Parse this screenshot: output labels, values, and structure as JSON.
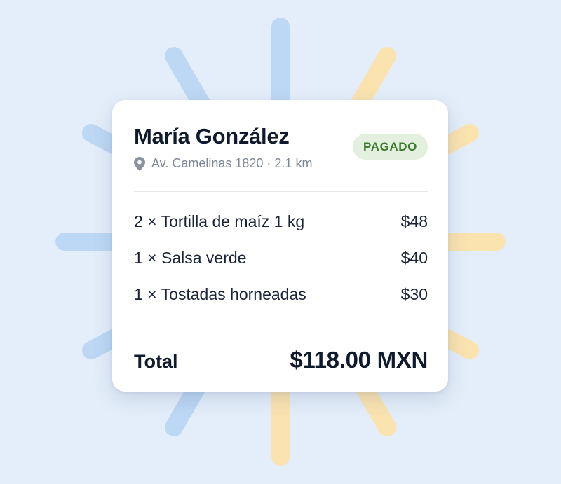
{
  "colors": {
    "background": "#e4eefa",
    "ray_blue": "#bcd8f4",
    "ray_yellow": "#fbe3b0",
    "card": "#ffffff",
    "badge_bg": "#e3f0df",
    "badge_text": "#3d7a2c",
    "text_primary": "#0f1b2d",
    "text_muted": "#7c8694"
  },
  "order": {
    "customer_name": "María González",
    "address_icon": "map-pin-icon",
    "address": "Av. Camelinas 1820 · 2.1 km",
    "status": "PAGADO",
    "items": [
      {
        "description": "2 × Tortilla de maíz 1 kg",
        "price": "$48"
      },
      {
        "description": "1 × Salsa verde",
        "price": "$40"
      },
      {
        "description": "1 × Tostadas horneadas",
        "price": "$30"
      }
    ],
    "total_label": "Total",
    "total_amount": "$118.00 MXN"
  }
}
